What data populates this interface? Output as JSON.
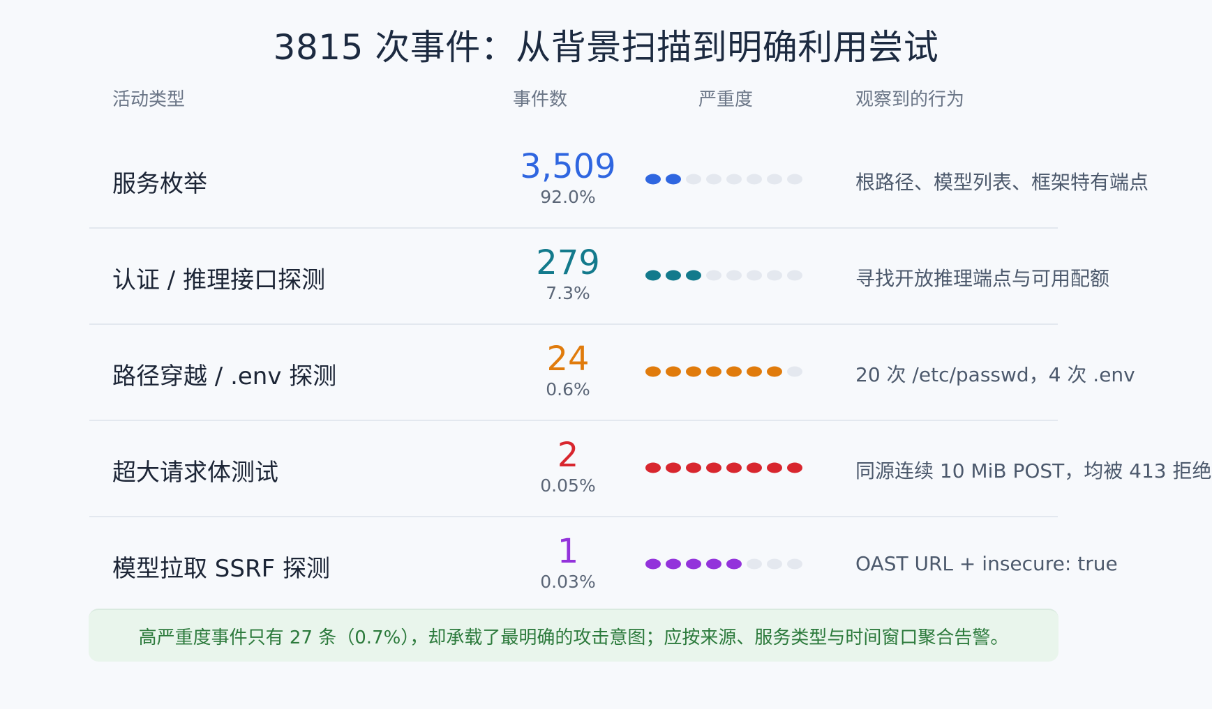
{
  "chart_data": {
    "type": "table",
    "title": "3815 次事件：从背景扫描到明确利用尝试",
    "columns": [
      "活动类型",
      "事件数",
      "严重度",
      "观察到的行为"
    ],
    "severity_scale_max": 8,
    "rows": [
      {
        "name": "服务枚举",
        "count": "3,509",
        "percent": "92.0%",
        "severity": 2,
        "color": "#2f66e0",
        "behavior": "根路径、模型列表、框架特有端点"
      },
      {
        "name": "认证 / 推理接口探测",
        "count": "279",
        "percent": "7.3%",
        "severity": 3,
        "color": "#137a8c",
        "behavior": "寻找开放推理端点与可用配额"
      },
      {
        "name": "路径穿越 / .env 探测",
        "count": "24",
        "percent": "0.6%",
        "severity": 7,
        "color": "#e07b0c",
        "behavior": "20 次 /etc/passwd，4 次 .env"
      },
      {
        "name": "超大请求体测试",
        "count": "2",
        "percent": "0.05%",
        "severity": 8,
        "color": "#d8262e",
        "behavior": "同源连续 10 MiB POST，均被 413 拒绝"
      },
      {
        "name": "模型拉取 SSRF 探测",
        "count": "1",
        "percent": "0.03%",
        "severity": 5,
        "color": "#9333db",
        "behavior": "OAST URL + insecure: true"
      }
    ],
    "empty_dot_color": "#e4e8ef"
  },
  "note": "高严重度事件只有 27 条（0.7%），却承载了最明确的攻击意图；应按来源、服务类型与时间窗口聚合告警。"
}
